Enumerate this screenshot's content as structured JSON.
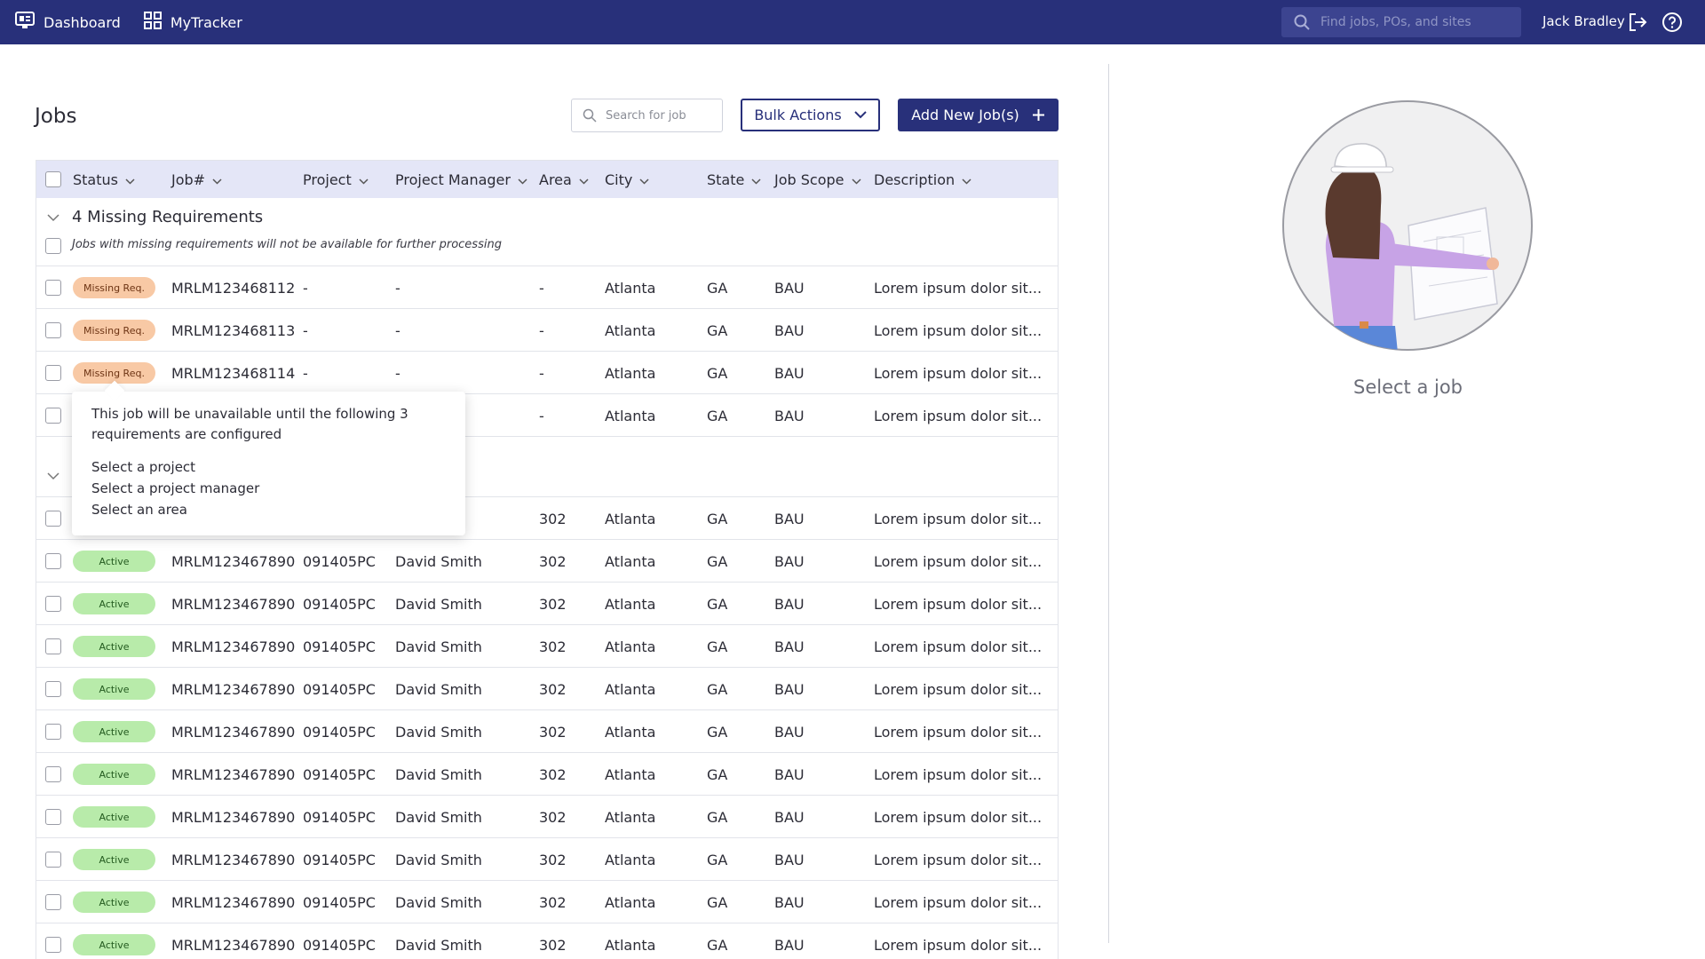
{
  "topbar": {
    "nav": [
      {
        "label": "Dashboard",
        "icon": "dashboard-icon"
      },
      {
        "label": "MyTracker",
        "icon": "grid-icon"
      }
    ],
    "search_placeholder": "Find jobs, POs, and sites",
    "user_name": "Jack Bradley"
  },
  "main": {
    "title": "Jobs",
    "search_placeholder": "Search for job",
    "bulk_actions_label": "Bulk Actions",
    "add_button_label": "Add New Job(s)",
    "columns": [
      "Status",
      "Job#",
      "Project",
      "Project Manager",
      "Area",
      "City",
      "State",
      "Job Scope",
      "Description"
    ],
    "missing_group": {
      "title": "4 Missing Requirements",
      "subtitle": "Jobs with missing requirements will not be available for further processing",
      "rows": [
        {
          "status": "Missing Req.",
          "job": "MRLM123468112",
          "project": "-",
          "manager": "-",
          "area": "-",
          "city": "Atlanta",
          "state": "GA",
          "scope": "BAU",
          "description": "Lorem ipsum dolor sit..."
        },
        {
          "status": "Missing Req.",
          "job": "MRLM123468113",
          "project": "-",
          "manager": "-",
          "area": "-",
          "city": "Atlanta",
          "state": "GA",
          "scope": "BAU",
          "description": "Lorem ipsum dolor sit..."
        },
        {
          "status": "Missing Req.",
          "job": "MRLM123468114",
          "project": "-",
          "manager": "-",
          "area": "-",
          "city": "Atlanta",
          "state": "GA",
          "scope": "BAU",
          "description": "Lorem ipsum dolor sit..."
        },
        {
          "status": "",
          "job": "",
          "project": "",
          "manager": "",
          "area": "-",
          "city": "Atlanta",
          "state": "GA",
          "scope": "BAU",
          "description": "Lorem ipsum dolor sit..."
        }
      ]
    },
    "active_rows": [
      {
        "status": "",
        "job": "",
        "project": "",
        "manager": "h",
        "area": "302",
        "city": "Atlanta",
        "state": "GA",
        "scope": "BAU",
        "description": "Lorem ipsum dolor sit..."
      },
      {
        "status": "Active",
        "job": "MRLM123467890",
        "project": "091405PC",
        "manager": "David Smith",
        "area": "302",
        "city": "Atlanta",
        "state": "GA",
        "scope": "BAU",
        "description": "Lorem ipsum dolor sit..."
      },
      {
        "status": "Active",
        "job": "MRLM123467890",
        "project": "091405PC",
        "manager": "David Smith",
        "area": "302",
        "city": "Atlanta",
        "state": "GA",
        "scope": "BAU",
        "description": "Lorem ipsum dolor sit..."
      },
      {
        "status": "Active",
        "job": "MRLM123467890",
        "project": "091405PC",
        "manager": "David Smith",
        "area": "302",
        "city": "Atlanta",
        "state": "GA",
        "scope": "BAU",
        "description": "Lorem ipsum dolor sit..."
      },
      {
        "status": "Active",
        "job": "MRLM123467890",
        "project": "091405PC",
        "manager": "David Smith",
        "area": "302",
        "city": "Atlanta",
        "state": "GA",
        "scope": "BAU",
        "description": "Lorem ipsum dolor sit..."
      },
      {
        "status": "Active",
        "job": "MRLM123467890",
        "project": "091405PC",
        "manager": "David Smith",
        "area": "302",
        "city": "Atlanta",
        "state": "GA",
        "scope": "BAU",
        "description": "Lorem ipsum dolor sit..."
      },
      {
        "status": "Active",
        "job": "MRLM123467890",
        "project": "091405PC",
        "manager": "David Smith",
        "area": "302",
        "city": "Atlanta",
        "state": "GA",
        "scope": "BAU",
        "description": "Lorem ipsum dolor sit..."
      },
      {
        "status": "Active",
        "job": "MRLM123467890",
        "project": "091405PC",
        "manager": "David Smith",
        "area": "302",
        "city": "Atlanta",
        "state": "GA",
        "scope": "BAU",
        "description": "Lorem ipsum dolor sit..."
      },
      {
        "status": "Active",
        "job": "MRLM123467890",
        "project": "091405PC",
        "manager": "David Smith",
        "area": "302",
        "city": "Atlanta",
        "state": "GA",
        "scope": "BAU",
        "description": "Lorem ipsum dolor sit..."
      },
      {
        "status": "Active",
        "job": "MRLM123467890",
        "project": "091405PC",
        "manager": "David Smith",
        "area": "302",
        "city": "Atlanta",
        "state": "GA",
        "scope": "BAU",
        "description": "Lorem ipsum dolor sit..."
      },
      {
        "status": "Active",
        "job": "MRLM123467890",
        "project": "091405PC",
        "manager": "David Smith",
        "area": "302",
        "city": "Atlanta",
        "state": "GA",
        "scope": "BAU",
        "description": "Lorem ipsum dolor sit..."
      }
    ],
    "tooltip": {
      "heading": "This job will be unavailable until the following 3 requirements are configured",
      "items": [
        "Select a project",
        "Select a project manager",
        "Select an area"
      ]
    }
  },
  "side": {
    "empty_label": "Select a job"
  },
  "colors": {
    "brand": "#28307a",
    "header_bg": "#e4e6f7",
    "missing_badge": "#f8c9a5",
    "active_badge": "#b8ebaa"
  }
}
